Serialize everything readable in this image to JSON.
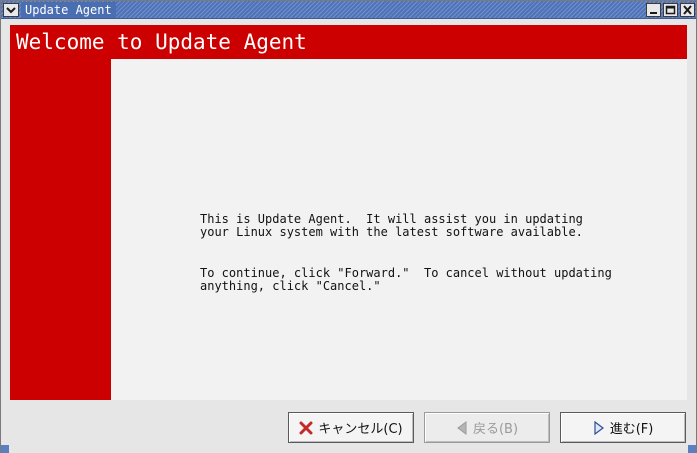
{
  "window": {
    "title": "Update Agent",
    "controls": {
      "menu_icon": "chevron-down-icon",
      "minimize_icon": "minimize-icon",
      "maximize_icon": "maximize-icon",
      "close_icon": "close-icon"
    }
  },
  "header": {
    "title": "Welcome to Update Agent"
  },
  "message": {
    "paragraph1_line1": "This is Update Agent.  It will assist you in updating",
    "paragraph1_line2": "your Linux system with the latest software available.",
    "paragraph2_line1": "To continue, click \"Forward.\"  To cancel without updating",
    "paragraph2_line2": "anything, click \"Cancel.\""
  },
  "buttons": {
    "cancel": {
      "label": "キャンセル(C)",
      "icon": "cancel-x-icon",
      "enabled": true
    },
    "back": {
      "label": "戻る(B)",
      "icon": "back-arrow-icon",
      "enabled": false
    },
    "forward": {
      "label": "進む(F)",
      "icon": "forward-arrow-icon",
      "enabled": true
    }
  },
  "colors": {
    "accent_red": "#cc0000",
    "titlebar_blue": "#5b7fc0",
    "content_bg": "#f2f2f2"
  }
}
